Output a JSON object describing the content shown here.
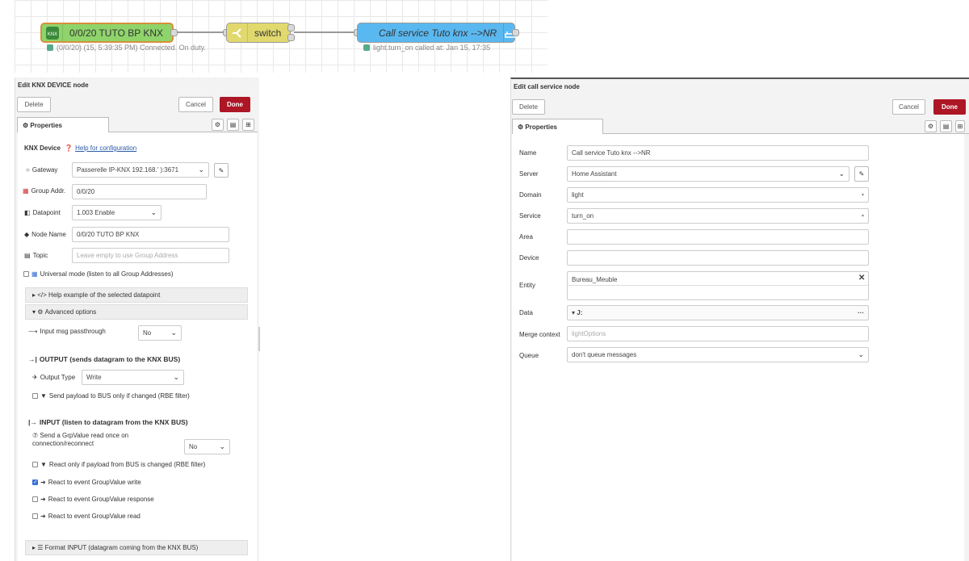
{
  "flow": {
    "knx_node": {
      "icon_text": "KNX",
      "label": "0/0/20 TUTO BP KNX",
      "status": "(0/0/20) (15, 5:39:35 PM) Connected. On duty."
    },
    "switch_node": {
      "label": "switch"
    },
    "call_node": {
      "label": "Call service Tuto knx -->NR",
      "status": "light.turn_on called at: Jan 15, 17:35"
    },
    "colors": {
      "knx_fill": "#8fd46b",
      "knx_border": "#d6903a",
      "switch_fill": "#e2d96e",
      "call_fill": "#5ab8f0",
      "status_green": "#55aa88"
    }
  },
  "knx_panel": {
    "title": "Edit KNX DEVICE node",
    "delete_label": "Delete",
    "cancel_label": "Cancel",
    "done_label": "Done",
    "tab_properties": "Properties",
    "device_label": "KNX Device",
    "help_link": "Help for configuration",
    "gateway_label": "Gateway",
    "gateway_value": "Passerelle IP-KNX 192.168.'        ):3671",
    "group_addr_label": "Group Addr.",
    "group_addr_value": "0/0/20",
    "datapoint_label": "Datapoint",
    "datapoint_value": "1.003 Enable",
    "node_name_label": "Node Name",
    "node_name_value": "0/0/20 TUTO BP KNX",
    "topic_label": "Topic",
    "topic_placeholder": "Leave empty to use Group Address",
    "universal_label": "Universal mode (listen to all Group Addresses)",
    "help_example_label": "</> Help example of the selected datapoint",
    "advanced_label": "Advanced options",
    "input_passthrough_label": "Input msg passthrough",
    "input_passthrough_value": "No",
    "output_header": "OUTPUT (sends datagram to the KNX BUS)",
    "output_type_label": "Output Type",
    "output_type_value": "Write",
    "send_rbe_label": "Send payload to BUS only if changed (RBE filter)",
    "input_header": "INPUT (listen to datagram from the KNX BUS)",
    "grpvalue_read_label_1": "Send a GrpValue read once on",
    "grpvalue_read_label_2": "connection/reconnect",
    "grpvalue_read_value": "No",
    "react_rbe_label": "React only if payload from BUS is changed (RBE filter)",
    "react_write_label": "React to event GroupValue write",
    "react_response_label": "React to event GroupValue response",
    "react_read_label": "React to event GroupValue read",
    "format_input_label": "Format INPUT (datagram coming from the KNX BUS)"
  },
  "call_panel": {
    "title": "Edit call service node",
    "delete_label": "Delete",
    "cancel_label": "Cancel",
    "done_label": "Done",
    "tab_properties": "Properties",
    "name_label": "Name",
    "name_value": "Call service Tuto knx -->NR",
    "server_label": "Server",
    "server_value": "Home Assistant",
    "domain_label": "Domain",
    "domain_value": "light",
    "service_label": "Service",
    "service_value": "turn_on",
    "area_label": "Area",
    "device_label": "Device",
    "entity_label": "Entity",
    "entity_value": "Bureau_Meuble",
    "data_label": "Data",
    "data_type": "J:",
    "merge_label": "Merge context",
    "merge_placeholder": "lightOptions",
    "queue_label": "Queue",
    "queue_value": "don't queue messages"
  }
}
